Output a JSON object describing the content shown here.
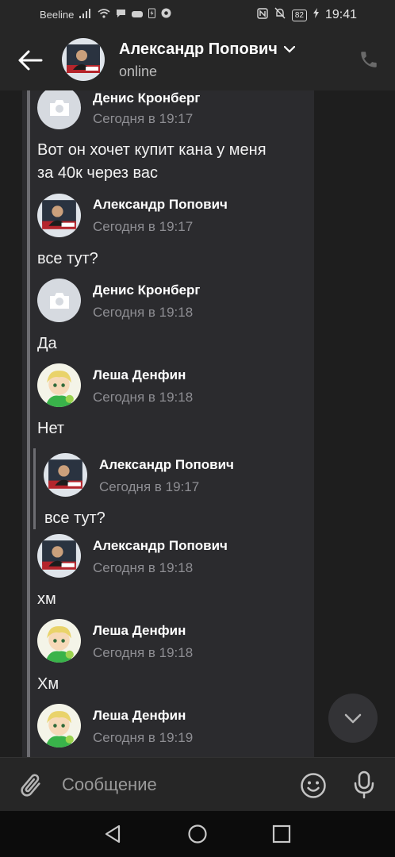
{
  "status_bar": {
    "carrier": "Beeline",
    "battery": "82",
    "time": "19:41"
  },
  "header": {
    "contact_name": "Александр Попович",
    "status": "online"
  },
  "messages": [
    {
      "author": "Денис Кронберг",
      "time": "Сегодня в 19:17",
      "text": "Вот он хочет купит кана у меня\nза 40к через вас",
      "avatar": "camera-placeholder"
    },
    {
      "author": "Александр Попович",
      "time": "Сегодня в 19:17",
      "text": "все тут?",
      "avatar": "photo"
    },
    {
      "author": "Денис Кронберг",
      "time": "Сегодня в 19:18",
      "text": "Да",
      "avatar": "camera-placeholder"
    },
    {
      "author": "Леша Денфин",
      "time": "Сегодня в 19:18",
      "text": "Нет",
      "avatar": "anime"
    },
    {
      "author": "Александр Попович",
      "time": "Сегодня в 19:17",
      "text": "все тут?",
      "avatar": "photo",
      "quoted": true
    },
    {
      "author": "Александр Попович",
      "time": "Сегодня в 19:18",
      "text": "хм",
      "avatar": "photo"
    },
    {
      "author": "Леша Денфин",
      "time": "Сегодня в 19:18",
      "text": "Хм",
      "avatar": "anime"
    },
    {
      "author": "Леша Денфин",
      "time": "Сегодня в 19:19",
      "text": "",
      "avatar": "anime"
    }
  ],
  "composer": {
    "placeholder": "Сообщение"
  },
  "colors": {
    "background": "#1e1e1e",
    "panel": "#2b2b2e",
    "bar": "#262626",
    "text_secondary": "#8e8e93"
  }
}
